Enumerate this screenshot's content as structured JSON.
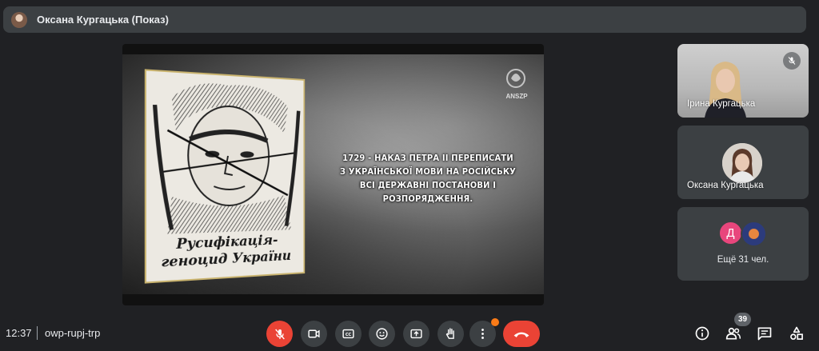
{
  "header": {
    "presenter": "Оксана Кургацька (Показ)"
  },
  "presentation": {
    "poster_line1": "Русифікація-",
    "poster_line2": "геноцид України",
    "caption_lines": [
      "1729 - НАКАЗ ПЕТРА II ПЕРЕПИСАТИ",
      "З УКРАЇНСЬКОЇ МОВИ НА РОСІЙСЬКУ",
      "ВСІ ДЕРЖАВНІ ПОСТАНОВИ І РОЗПОРЯДЖЕННЯ."
    ],
    "logo_text": "ANSZP"
  },
  "participants": {
    "tile1_name": "Ірина Кургацька",
    "tile2_name": "Оксана Кургацька",
    "more_initial": "Д",
    "more_label": "Ещё 31 чел."
  },
  "bottombar": {
    "time": "12:37",
    "meeting_code": "owp-rupj-trp",
    "people_count": "39"
  },
  "colors": {
    "background": "#202124",
    "surface": "#3c4043",
    "danger": "#ea4335",
    "accent": "#fa7b17",
    "avatar_pink": "#e8467c"
  },
  "icons": [
    "mic-off-icon",
    "camera-icon",
    "captions-icon",
    "emoji-icon",
    "present-icon",
    "hand-icon",
    "more-vert-icon",
    "call-end-icon",
    "info-icon",
    "people-icon",
    "chat-icon",
    "activities-icon"
  ]
}
